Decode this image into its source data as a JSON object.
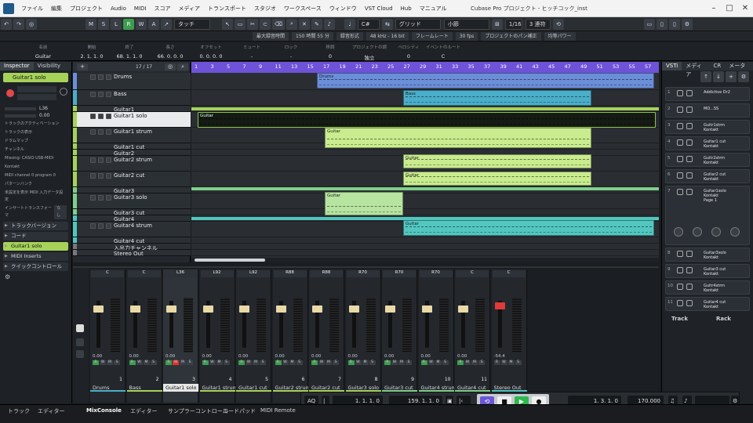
{
  "menu": {
    "items": [
      "ファイル",
      "編集",
      "プロジェクト",
      "Audio",
      "MIDI",
      "スコア",
      "メディア",
      "トランスポート",
      "スタジオ",
      "ワークスペース",
      "ウィンドウ",
      "VST Cloud",
      "Hub",
      "マニュアル"
    ],
    "window_title": "Cubase Pro プロジェクト - ヒッチコック_inst"
  },
  "toolbar": {
    "mode_buttons": [
      "M",
      "S",
      "L",
      "R",
      "W",
      "A"
    ],
    "touch_mode": "タッチ",
    "key": "C#",
    "grid": "グリッド",
    "bar": "小節",
    "quantize": "1/16",
    "triplet": "3 連符"
  },
  "status": {
    "rec_time": "最大録音時間",
    "rec_time_val": "150 時間 55 分",
    "rec_format": "録音形式",
    "rec_format_val": "48 kHz - 16 bit",
    "frame_rate": "フレームレート",
    "frame_rate_val": "30 fps",
    "pan_law": "プロジェクトのパン補正",
    "pan_law_val": "均等パワー"
  },
  "infoline": [
    {
      "h": "名前",
      "v": "Guitar"
    },
    {
      "h": "開始",
      "v": "2. 1. 1.  0"
    },
    {
      "h": "終了",
      "v": "68. 1. 1.  0"
    },
    {
      "h": "長さ",
      "v": "66. 0. 0.  0"
    },
    {
      "h": "オフセット",
      "v": "0. 0. 0.  0"
    },
    {
      "h": "ミュート",
      "v": "-"
    },
    {
      "h": "ロック",
      "v": "-"
    },
    {
      "h": "移調",
      "v": "0"
    },
    {
      "h": "プロジェクトの調",
      "v": "独立"
    },
    {
      "h": "ベロシティ",
      "v": "0"
    },
    {
      "h": "イベントのルート",
      "v": "C"
    }
  ],
  "inspector": {
    "tabs": [
      "Inspector",
      "Visibility"
    ],
    "track_name": "Guitar1 solo",
    "volume": "0.00",
    "pan": "L36",
    "midi_in": "Missing: CASIO USB-MIDI",
    "instrument": "Kontakt",
    "channel_prog": "MIDI channel 0 program 0",
    "insert_label": "インサートトランスフォーマ",
    "insert_value": "なし",
    "sections": [
      "トラックバージョン",
      "コード"
    ],
    "track_name2": "Guitar1 solo",
    "sections2": [
      "MIDI Inserts",
      "クイックコントロール"
    ],
    "lines": [
      "トラックのアクティベーション",
      "トラックの表示",
      "ドラムマップ",
      "チャンネル",
      "Missing: CASIO USB-MIDI",
      "Kontakt",
      "MIDI channel 0 program 0",
      "パターンバンク",
      "未設定を表示 MIDI 入力データ設定"
    ]
  },
  "tracklist": {
    "count": "17 / 17",
    "tracks": [
      "Drums",
      "Bass",
      "Guitar1",
      "Guitar1 solo",
      "Guitar1 strum",
      "Guitar1 cut",
      "Guitar2",
      "Guitar2 strum",
      "Guitar2 cut",
      "Guitar3",
      "Guitar3 solo",
      "Guitar3 cut",
      "Guitar4",
      "Guitar4 strum",
      "Guitar4 cut",
      "入出力チャンネル",
      "Stereo Out"
    ]
  },
  "ruler": {
    "ticks": [
      "1",
      "3",
      "5",
      "7",
      "9",
      "11",
      "13",
      "15",
      "17",
      "19",
      "21",
      "23",
      "25",
      "27",
      "29",
      "31",
      "33",
      "35",
      "37",
      "39",
      "41",
      "43",
      "45",
      "47",
      "49",
      "51",
      "53",
      "55",
      "57"
    ]
  },
  "parts": [
    {
      "label": "Drums",
      "color": "#6b8ed8"
    },
    {
      "label": "Bass",
      "color": "#4aaec9"
    },
    {
      "label": "Guitar",
      "color": "#c9ec8e"
    },
    {
      "label": "Guitar",
      "color": "#c9ec8e"
    },
    {
      "label": "Guitar",
      "color": "#c9ec8e"
    },
    {
      "label": "Guitar",
      "color": "#c9ec8e"
    },
    {
      "label": "Guitar",
      "color": "#b7e4a0"
    },
    {
      "label": "Guitar",
      "color": "#52c7c0"
    }
  ],
  "mixer": {
    "channels": [
      {
        "name": "Drums",
        "num": "1",
        "pan": "C",
        "val": "0.00"
      },
      {
        "name": "Bass",
        "num": "2",
        "pan": "C",
        "val": "0.00"
      },
      {
        "name": "Guitar1 solo",
        "num": "3",
        "pan": "L36",
        "val": "0.00"
      },
      {
        "name": "Guitar1 strum",
        "num": "4",
        "pan": "L92",
        "val": "0.00"
      },
      {
        "name": "Guitar1 cut",
        "num": "5",
        "pan": "L92",
        "val": "0.00"
      },
      {
        "name": "Guitar2 strum",
        "num": "6",
        "pan": "R88",
        "val": "0.00"
      },
      {
        "name": "Guitar2 cut",
        "num": "7",
        "pan": "R88",
        "val": "0.00"
      },
      {
        "name": "Guitar3 solo",
        "num": "8",
        "pan": "R70",
        "val": "0.00"
      },
      {
        "name": "Guitar3 cut",
        "num": "9",
        "pan": "R70",
        "val": "0.00"
      },
      {
        "name": "Guitar4 strum",
        "num": "10",
        "pan": "R70",
        "val": "0.00"
      },
      {
        "name": "Guitar4 cut",
        "num": "11",
        "pan": "C",
        "val": "0.00"
      },
      {
        "name": "Stereo Out",
        "num": "",
        "pan": "C",
        "val": "-54.4"
      }
    ]
  },
  "vsti": {
    "tabs": [
      "VSTi",
      "メディア",
      "CR",
      "メーター"
    ],
    "slots": [
      {
        "n": "1",
        "name": "Addictive Dr2"
      },
      {
        "n": "2",
        "name": "MO...SS"
      },
      {
        "n": "3",
        "name": "Guitr1strm\nKontakt"
      },
      {
        "n": "4",
        "name": "Guitar1 cut\nKontakt"
      },
      {
        "n": "5",
        "name": "Guitr2strm\nKontakt"
      },
      {
        "n": "6",
        "name": "Guitar2 cut\nKontakt"
      },
      {
        "n": "7",
        "name": "Guitar1solo\nKontakt\nPage 1"
      },
      {
        "n": "8",
        "name": "Guitar3solo\nKontakt"
      },
      {
        "n": "9",
        "name": "Guitar3 cut\nKontakt"
      },
      {
        "n": "10",
        "name": "Guitr4strm\nKontakt"
      },
      {
        "n": "11",
        "name": "Guitar4 cut\nKontakt"
      }
    ],
    "footer_track": "Track",
    "footer_rack": "Rack"
  },
  "transport": {
    "aq": "AQ",
    "left": "1. 1. 1.  0",
    "right": "159. 1. 1.  0",
    "pos": "1. 3. 1.  0",
    "tempo": "170.000"
  },
  "bottom_tabs": [
    "トラック",
    "エディター",
    "MixConsole",
    "エディター",
    "サンプラーコントロール",
    "コードパッド",
    "MIDI Remote"
  ]
}
